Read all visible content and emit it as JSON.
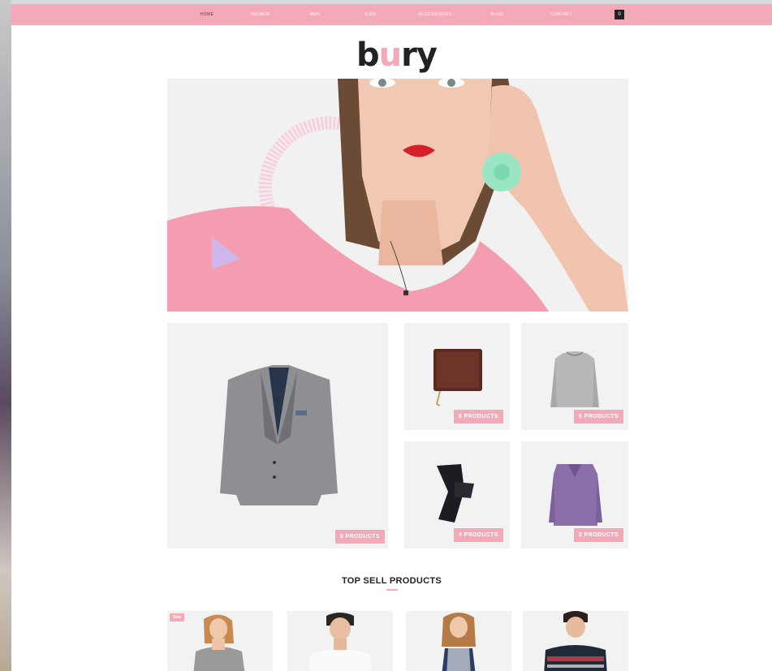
{
  "store": {
    "logo_text_b": "b",
    "logo_text_u": "u",
    "logo_text_rest": "ry"
  },
  "nav": {
    "items": [
      "Home",
      "Women",
      "Men",
      "Kids",
      "Accessories",
      "Blog",
      "Contact"
    ],
    "active_index": 0,
    "cart_count": "0"
  },
  "categories": [
    {
      "name": "blazer",
      "count_label": "8 products"
    },
    {
      "name": "wallet",
      "count_label": "8 products"
    },
    {
      "name": "sweater",
      "count_label": "5 products"
    },
    {
      "name": "pants",
      "count_label": "4 products"
    },
    {
      "name": "shirt",
      "count_label": "2 products"
    }
  ],
  "top_sell": {
    "title": "TOP SELL PRODUCTS",
    "sale_badge": "Sale"
  },
  "colors": {
    "accent": "#f3a9b8",
    "tile_bg": "#f2f2f3"
  }
}
